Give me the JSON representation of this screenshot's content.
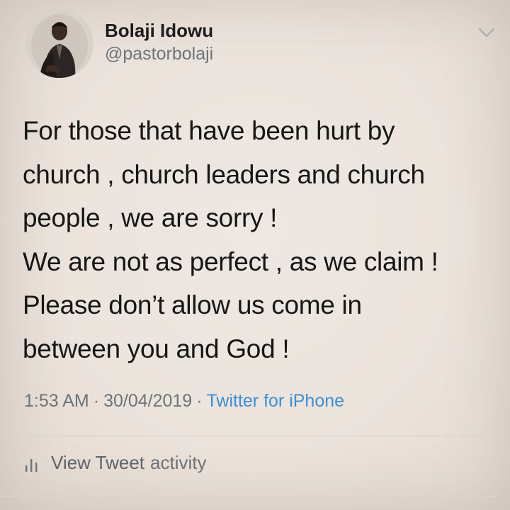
{
  "tweet": {
    "author": {
      "display_name": "Bolaji Idowu",
      "handle": "@pastorbolaji",
      "avatar_icon": "profile-photo"
    },
    "menu_icon": "chevron-down-icon",
    "text_lines": [
      "For those that have been hurt by",
      "church , church leaders and church",
      "people , we are sorry !",
      "We are not as perfect , as we claim !",
      "Please don’t allow us come in",
      "between you and God !"
    ],
    "meta": {
      "time": "1:53 AM",
      "separator": "·",
      "date": "30/04/2019",
      "source": "Twitter for iPhone"
    },
    "activity": {
      "icon": "bar-chart-icon",
      "label_primary": "View Tweet",
      "label_secondary": "activity"
    }
  },
  "colors": {
    "background": "#ebe3dc",
    "text": "#161616",
    "muted": "#6e7378",
    "link": "#3b8fd6"
  }
}
